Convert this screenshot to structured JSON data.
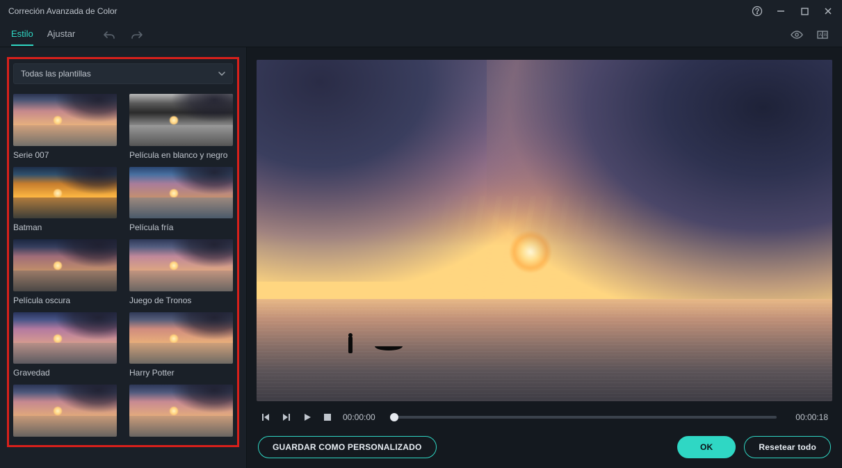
{
  "window": {
    "title": "Correción Avanzada de Color"
  },
  "tabs": {
    "style": "Estilo",
    "adjust": "Ajustar"
  },
  "sidebar": {
    "dropdown_label": "Todas las plantillas",
    "templates": [
      {
        "label": "Serie 007",
        "variant": "v-007"
      },
      {
        "label": "Película en blanco y negro",
        "variant": "v-bw"
      },
      {
        "label": "Batman",
        "variant": "v-batman"
      },
      {
        "label": "Película fría",
        "variant": "v-cold"
      },
      {
        "label": "Película oscura",
        "variant": "v-dark"
      },
      {
        "label": "Juego de Tronos",
        "variant": "v-got"
      },
      {
        "label": "Gravedad",
        "variant": "v-gravity"
      },
      {
        "label": "Harry Potter",
        "variant": "v-hp"
      },
      {
        "label": "",
        "variant": "v-x1"
      },
      {
        "label": "",
        "variant": "v-x2"
      }
    ]
  },
  "playback": {
    "current": "00:00:00",
    "duration": "00:00:18"
  },
  "buttons": {
    "save_custom": "GUARDAR COMO PERSONALIZADO",
    "ok": "OK",
    "reset": "Resetear todo"
  },
  "icons": {
    "help": "help-icon",
    "minimize": "minimize-icon",
    "maximize": "maximize-icon",
    "close": "close-icon",
    "undo": "undo-icon",
    "redo": "redo-icon",
    "visibility": "eye-icon",
    "compare": "compare-icon",
    "chevron": "chevron-down-icon",
    "prev_frame": "prev-frame-icon",
    "next_frame": "next-frame-icon",
    "play": "play-icon",
    "stop": "stop-icon"
  }
}
